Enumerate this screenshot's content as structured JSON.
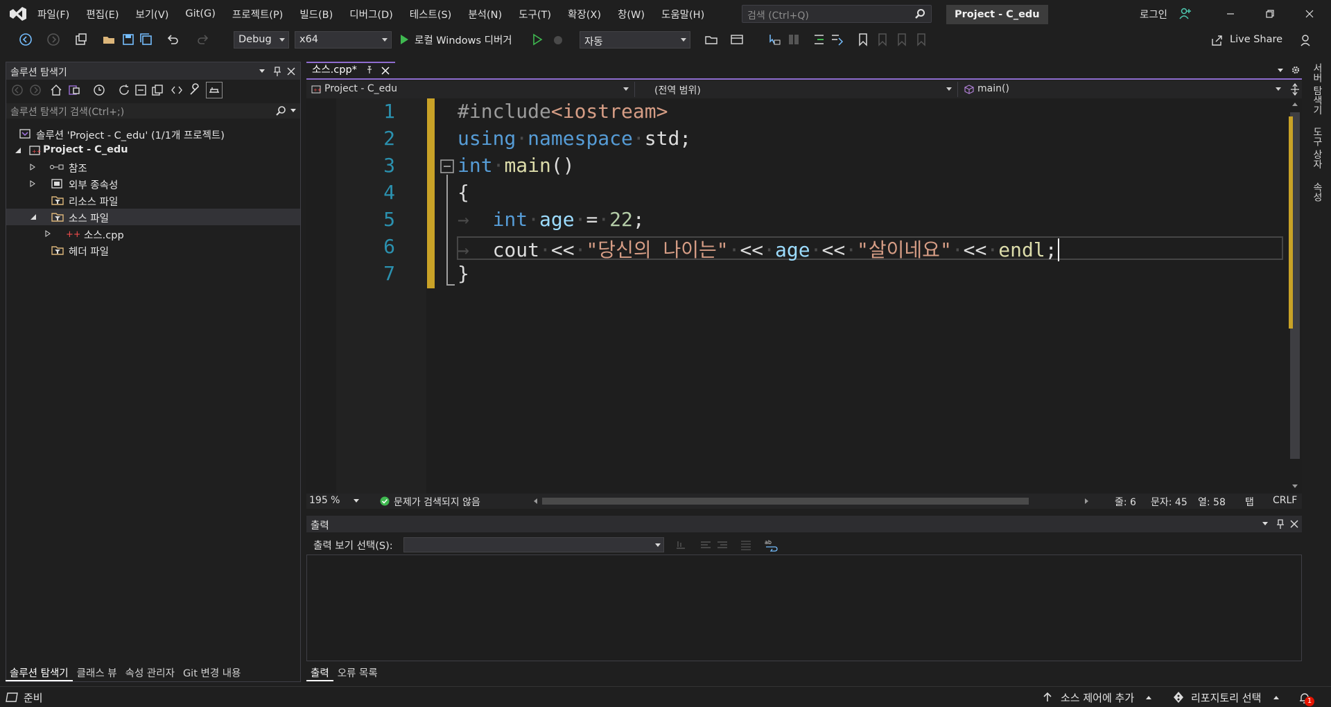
{
  "titlebar": {
    "menu": [
      "파일(F)",
      "편집(E)",
      "보기(V)",
      "Git(G)",
      "프로젝트(P)",
      "빌드(B)",
      "디버그(D)",
      "테스트(S)",
      "분석(N)",
      "도구(T)",
      "확장(X)",
      "창(W)",
      "도움말(H)"
    ],
    "search_placeholder": "검색 (Ctrl+Q)",
    "project_title": "Project - C_edu",
    "login": "로그인"
  },
  "toolbar": {
    "config": "Debug",
    "platform": "x64",
    "debugger": "로컬 Windows 디버거",
    "auto": "자동",
    "live_share": "Live Share"
  },
  "solution_explorer": {
    "title": "솔루션 탐색기",
    "search_placeholder": "솔루션 탐색기 검색(Ctrl+;)",
    "tree": [
      {
        "label": "솔루션 'Project - C_edu' (1/1개 프로젝트)"
      },
      {
        "label": "Project - C_edu"
      },
      {
        "label": "참조"
      },
      {
        "label": "외부 종속성"
      },
      {
        "label": "리소스 파일"
      },
      {
        "label": "소스 파일"
      },
      {
        "label": "소스.cpp"
      },
      {
        "label": "헤더 파일"
      }
    ],
    "tabs": [
      "솔루션 탐색기",
      "클래스 뷰",
      "속성 관리자",
      "Git 변경 내용"
    ]
  },
  "editor": {
    "tab_label": "소스.cpp*",
    "nav_project": "Project - C_edu",
    "nav_scope": "(전역 범위)",
    "nav_member": "main()",
    "line_numbers": [
      "1",
      "2",
      "3",
      "4",
      "5",
      "6",
      "7"
    ],
    "code": {
      "l1_a": "#include",
      "l1_b": "<iostream>",
      "l2_a": "using",
      "l2_b": "namespace",
      "l2_c": "std;",
      "l3_a": "int",
      "l3_b": "main",
      "l3_c": "()",
      "l4": "{",
      "l5_a": "int",
      "l5_b": "age",
      "l5_c": "=",
      "l5_d": "22",
      "l5_e": ";",
      "l6_a": "cout",
      "l6_b": "<<",
      "l6_c": "\"당신의 나이는\"",
      "l6_d": "<<",
      "l6_e": "age",
      "l6_f": "<<",
      "l6_g": "\"살이네요\"",
      "l6_h": "<<",
      "l6_i": "endl",
      "l6_j": ";",
      "l7": "}"
    },
    "zoom": "195 %",
    "issues": "문제가 검색되지 않음",
    "line_info": "줄: 6",
    "char_info": "문자: 45",
    "col_info": "열: 58",
    "indent": "탭",
    "eol": "CRLF"
  },
  "output": {
    "title": "출력",
    "source_label": "출력 보기 선택(S):",
    "tabs": [
      "출력",
      "오류 목록"
    ]
  },
  "rail": [
    "서버 탐색기",
    "도구 상자",
    "속성"
  ],
  "status": {
    "ready": "준비",
    "source_control": "소스 제어에 추가",
    "repo": "리포지토리 선택",
    "notifications": "1"
  },
  "colors": {
    "accent": "#8f6dd0",
    "change_marker": "#c9a227",
    "keyword": "#569cd6",
    "string": "#d69d85"
  }
}
